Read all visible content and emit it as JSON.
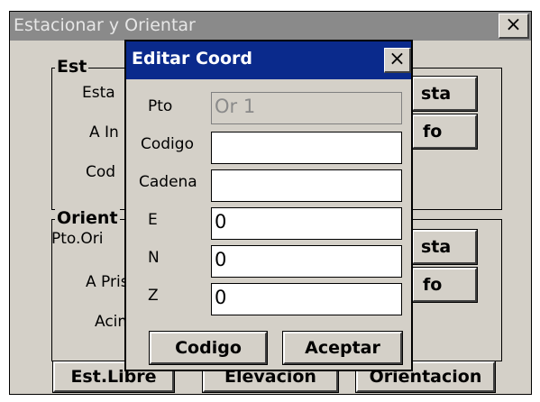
{
  "window": {
    "title": "Estacionar y Orientar",
    "close_glyph": "×"
  },
  "background": {
    "group_est_label": "Est",
    "est_labels": [
      "Esta",
      "A In",
      "Cod"
    ],
    "group_orient_label": "Orient",
    "orient_labels": [
      "Pto.Ori",
      "A Pris",
      "Acim"
    ],
    "right_buttons": [
      "sta",
      "fo",
      "sta",
      "fo"
    ],
    "bottom_buttons": [
      "Est.Libre",
      "Elevacion",
      "Orientacion"
    ]
  },
  "dialog": {
    "title": "Editar Coord",
    "close_glyph": "×",
    "fields": [
      {
        "label": "Pto",
        "value": "Or 1"
      },
      {
        "label": "Codigo",
        "value": ""
      },
      {
        "label": "Cadena",
        "value": ""
      },
      {
        "label": "E",
        "value": "0"
      },
      {
        "label": "N",
        "value": "0"
      },
      {
        "label": "Z",
        "value": "0"
      }
    ],
    "codigo_button": "Codigo",
    "aceptar_button": "Aceptar"
  }
}
